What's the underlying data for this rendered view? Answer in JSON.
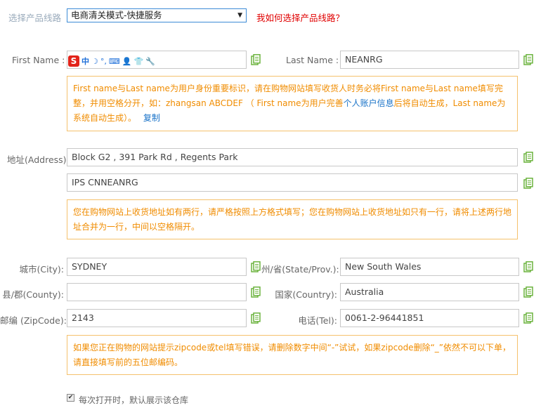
{
  "route": {
    "label": "选择产品线路",
    "selected": "电商清关模式-快捷服务",
    "help_link": "我如何选择产品线路？"
  },
  "name": {
    "first_label": "First Name :",
    "first_value": "",
    "last_label": "Last Name :",
    "last_value": "NEANRG",
    "note_part1": "First name与Last name为用户身份重要标识，请在购物网站填写收货人时务必将First name与Last name填写完整，并用空格分开，如：zhangsan ABCDEF （ First name为用户完善",
    "note_link": "个人账户信息",
    "note_part2": "后将自动生成，Last name为系统自动生成）。",
    "note_copy": "复制"
  },
  "ime_icons": [
    "S",
    "中",
    "☽",
    "°,",
    "⌨",
    "👤",
    "👕",
    "🔧"
  ],
  "address": {
    "label": "地址(Address):",
    "line1": "Block G2 , 391 Park Rd , Regents Park",
    "line2": "IPS CNNEANRG",
    "note": "您在购物网站上收货地址如有两行，请严格按照上方格式填写；您在购物网站上收货地址如只有一行，请将上述两行地址合并为一行，中间以空格隔开。"
  },
  "city": {
    "label": "城市(City):",
    "value": "SYDNEY"
  },
  "state": {
    "label": "州/省(State/Prov.):",
    "value": "New South Wales"
  },
  "county": {
    "label": "县/郡(County):",
    "value": ""
  },
  "country": {
    "label": "国家(Country):",
    "value": "Australia"
  },
  "zip": {
    "label": "邮编 (ZipCode):",
    "value": "2143"
  },
  "tel": {
    "label": "电话(Tel):",
    "value": "0061-2-96441851"
  },
  "zip_note": "如果您正在购物的网站提示zipcode或tel填写错误，请删除数字中间“-”试试，如果zipcode删除“_”依然不可以下单，请直接填写前的五位邮编码。",
  "default_checkbox": {
    "checked": true,
    "label": "每次打开时，默认展示该仓库"
  },
  "colors": {
    "note_border": "#f5c16c",
    "note_text": "#f08c00",
    "copy_icon": "#6cb33e",
    "link_red": "#e00000"
  }
}
